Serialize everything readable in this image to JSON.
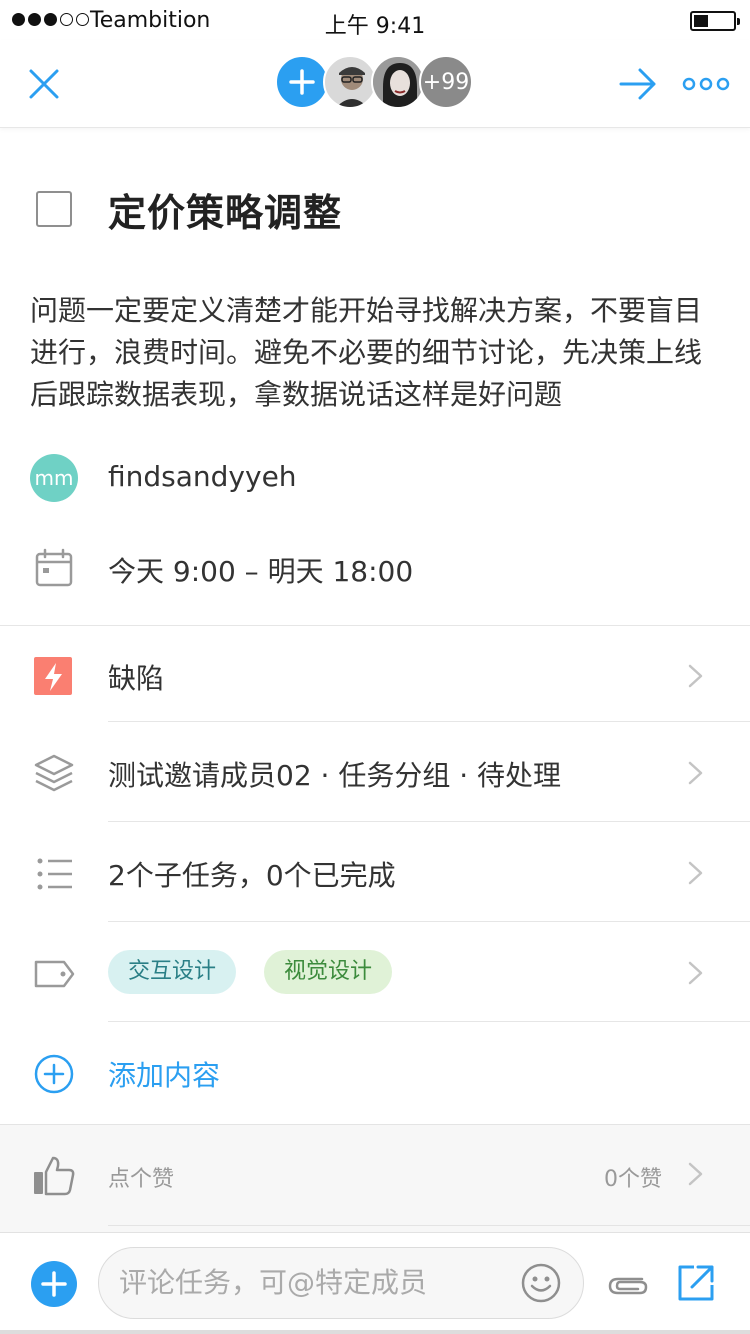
{
  "status_bar": {
    "carrier": "Teambition",
    "time": "上午 9:41",
    "signal_strength": 3,
    "battery_level": 0.3
  },
  "nav": {
    "more_members_count": "+99",
    "accent_color": "#2b9ff1"
  },
  "task": {
    "title": "定价策略调整",
    "completed": false,
    "description": "问题一定要定义清楚才能开始寻找解决方案，不要盲目进行，浪费时间。避免不必要的细节讨论，先决策上线后跟踪数据表现，拿数据说话这样是好问题",
    "executor": {
      "avatar_initials": "mm",
      "name": "findsandyyeh"
    },
    "date_range": "今天 9:00 – 明天 18:00"
  },
  "rows": {
    "type_label": "缺陷",
    "project_path": "测试邀请成员02 · 任务分组 · 待处理",
    "subtasks": "2个子任务，0个已完成",
    "tags": [
      "交互设计",
      "视觉设计"
    ],
    "add_content": "添加内容"
  },
  "likes": {
    "label": "点个赞",
    "count_text": "0个赞"
  },
  "comment_bar": {
    "placeholder": "评论任务，可@特定成员"
  },
  "colors": {
    "accent": "#2b9ff1",
    "bug_red": "#fa7f71",
    "executor_teal": "#6fd1c5"
  }
}
